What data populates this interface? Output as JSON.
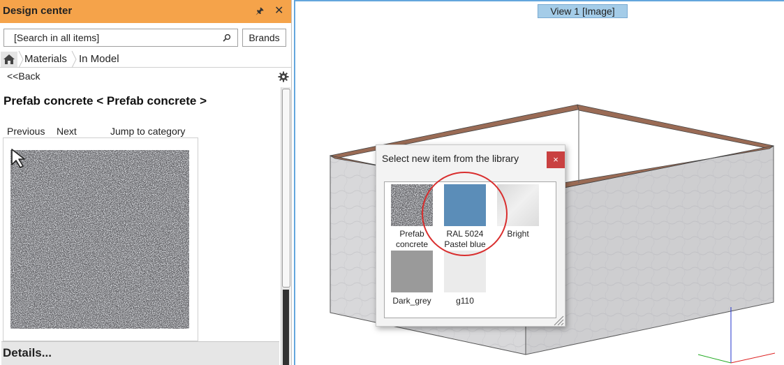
{
  "panel": {
    "title": "Design center",
    "search_placeholder": "[Search in all items]",
    "brands_label": "Brands",
    "breadcrumb": [
      "Materials",
      "In Model"
    ],
    "back_label": "<<Back",
    "heading": "Prefab concrete < Prefab concrete >",
    "nav": {
      "previous": "Previous",
      "next": "Next",
      "jump": "Jump to category"
    },
    "details_label": "Details...",
    "pin_glyph": "🖈",
    "close_glyph": "✕"
  },
  "viewport": {
    "tab_label": "View 1 [Image]"
  },
  "dialog": {
    "title": "Select new item from the library",
    "close_glyph": "×",
    "items": [
      {
        "label_line1": "Prefab",
        "label_line2": "concrete",
        "swatch": "texture"
      },
      {
        "label_line1": "RAL 5024",
        "label_line2": "Pastel blue",
        "swatch": "#5b8db8"
      },
      {
        "label_line1": "Bright",
        "label_line2": "",
        "swatch": "#e4e4e4"
      },
      {
        "label_line1": "Dark_grey",
        "label_line2": "",
        "swatch": "#9a9a9a"
      },
      {
        "label_line1": "g110",
        "label_line2": "",
        "swatch": "#ebebeb"
      }
    ]
  },
  "colors": {
    "titlebar": "#f5a34a",
    "accent_blue": "#63a6dd",
    "highlight_circle": "#d92e2e"
  }
}
